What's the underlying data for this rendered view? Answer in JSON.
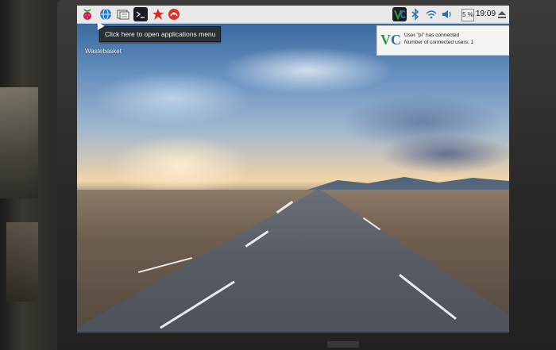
{
  "taskbar": {
    "icons": [
      {
        "name": "raspberry-menu-icon",
        "glyph": "●"
      },
      {
        "name": "web-browser-icon",
        "glyph": "◍"
      },
      {
        "name": "file-manager-icon",
        "glyph": "▤"
      },
      {
        "name": "terminal-icon",
        "glyph": ">_"
      },
      {
        "name": "math-kernel-icon",
        "glyph": "✹"
      },
      {
        "name": "wolfram-icon",
        "glyph": "◐"
      }
    ],
    "tray": {
      "vnc_glyph": "V",
      "cpu_label": "5 %",
      "clock": "19:09"
    }
  },
  "tooltip": {
    "text": "Click here to open applications menu"
  },
  "desktop": {
    "wastebasket_label": "Wastebasket"
  },
  "notification": {
    "logo_v": "V",
    "logo_c": "C",
    "line1": "User \"pi\" has connected",
    "line2": "Number of connected users: 1"
  },
  "colors": {
    "vnc_green": "#2f9a3a",
    "vnc_blue": "#2a6fb5",
    "raspberry_red": "#c51a4a",
    "browser_blue": "#2e7bc9"
  }
}
